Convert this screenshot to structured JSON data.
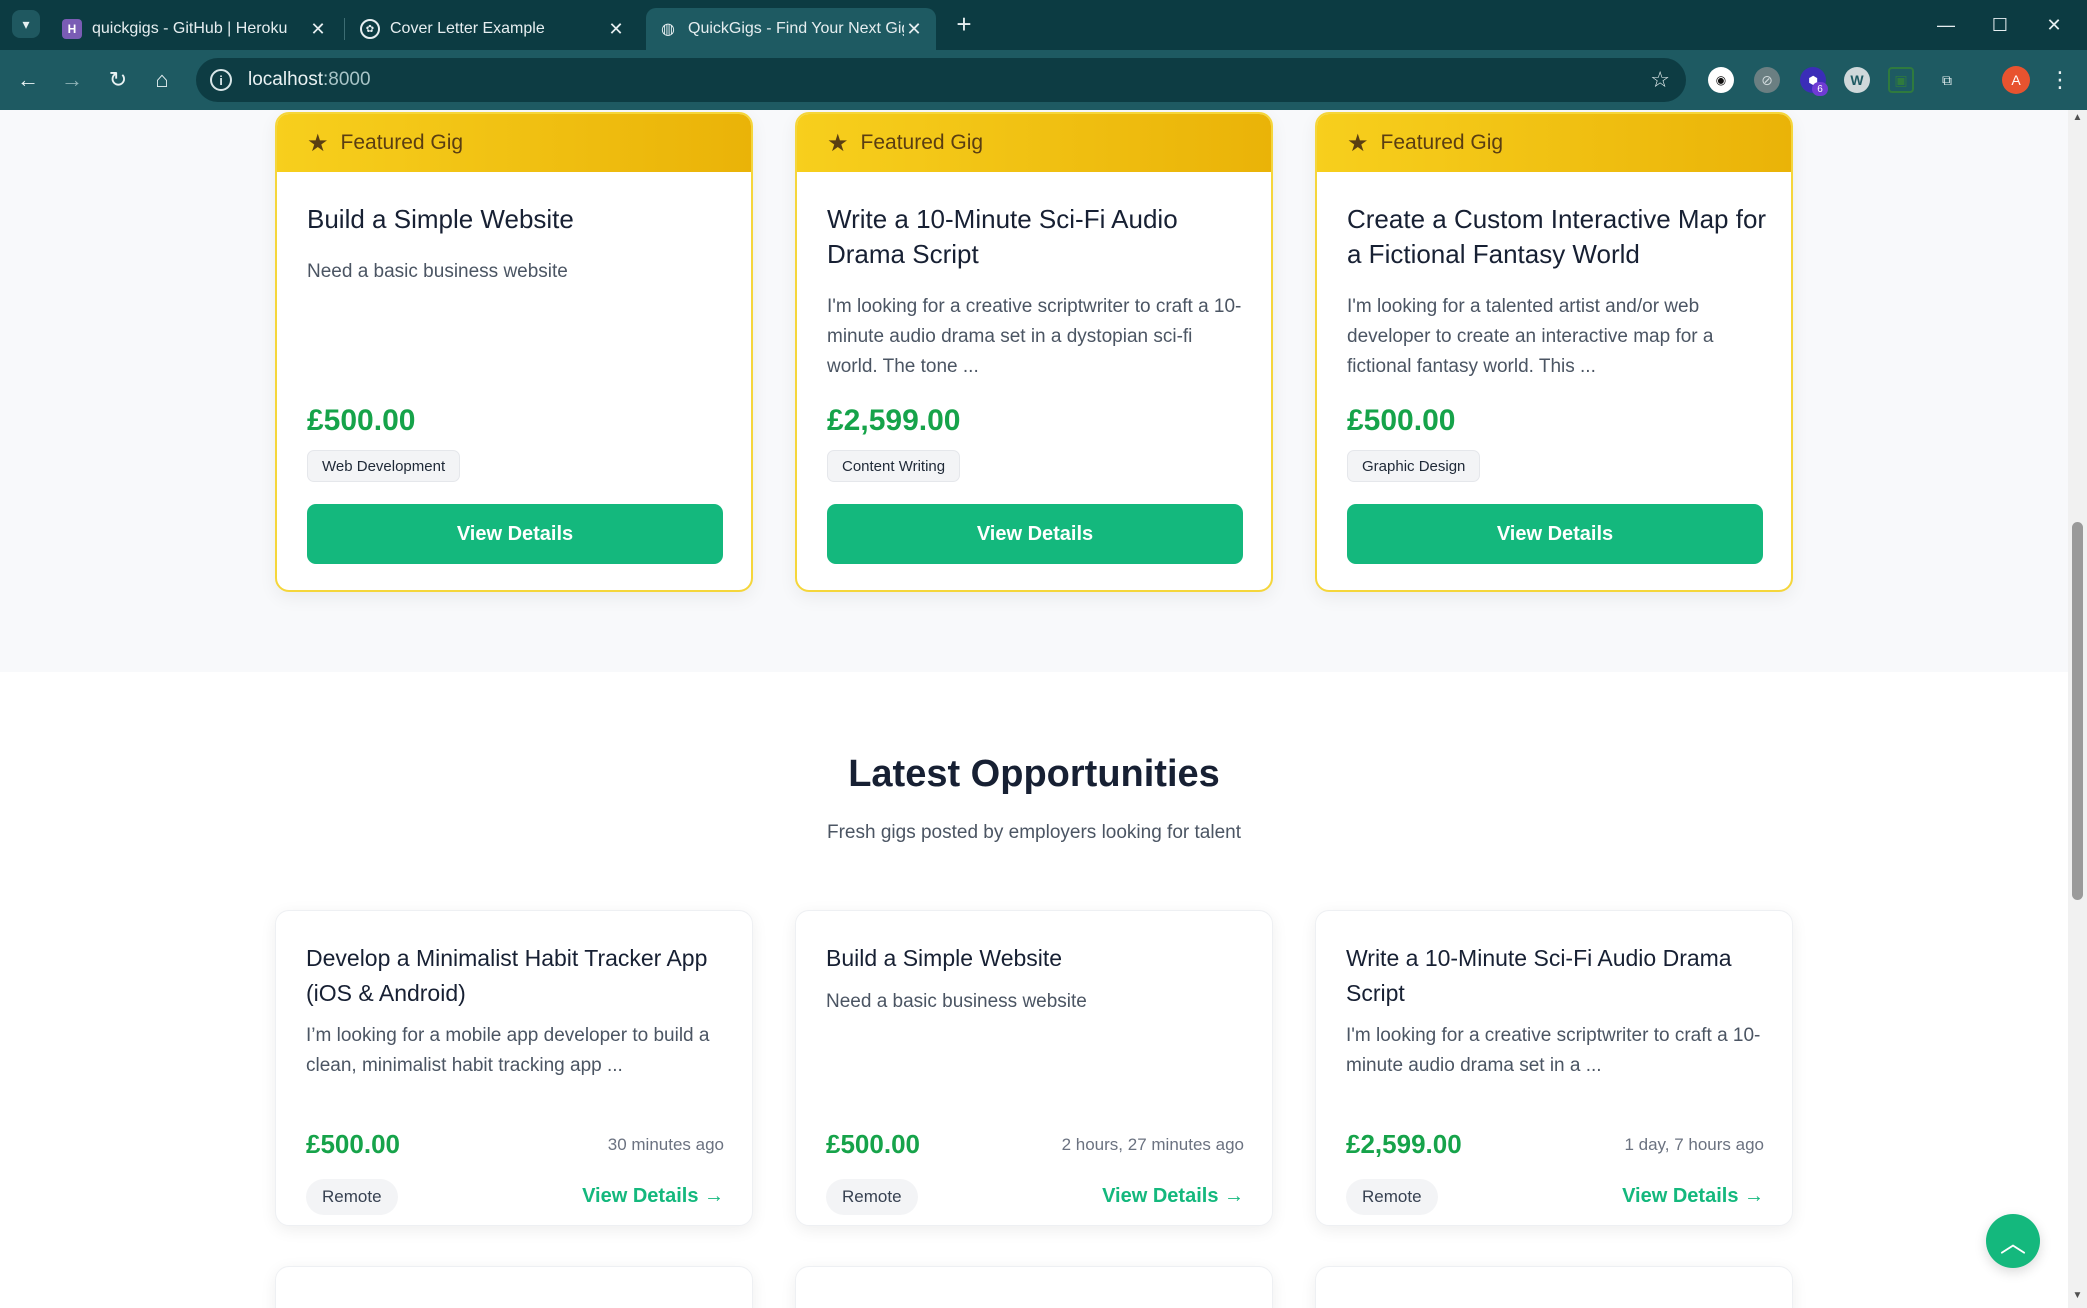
{
  "browser": {
    "tabs": [
      {
        "title": "quickgigs - GitHub | Heroku",
        "favicon": "heroku-icon"
      },
      {
        "title": "Cover Letter Example",
        "favicon": "openai-icon"
      },
      {
        "title": "QuickGigs - Find Your Next Gig",
        "favicon": "globe-icon"
      }
    ],
    "active_tab": 2,
    "url_host": "localhost",
    "url_port": ":8000",
    "profile_initial": "A",
    "extension_badge": "6"
  },
  "featured": {
    "badge_label": "Featured Gig",
    "button_label": "View Details",
    "cards": [
      {
        "title": "Build a Simple Website",
        "description": "Need a basic business website",
        "price": "£500.00",
        "category": "Web Development"
      },
      {
        "title": "Write a 10-Minute Sci-Fi Audio Drama Script",
        "description": "I'm looking for a creative scriptwriter to craft a 10-minute audio drama set in a dystopian sci-fi world. The tone ...",
        "price": "£2,599.00",
        "category": "Content Writing"
      },
      {
        "title": "Create a Custom Interactive Map for a Fictional Fantasy World",
        "description": "I'm looking for a talented artist and/or web developer to create an interactive map for a fictional fantasy world. This ...",
        "price": "£500.00",
        "category": "Graphic Design"
      }
    ]
  },
  "latest": {
    "title": "Latest Opportunities",
    "subtitle": "Fresh gigs posted by employers looking for talent",
    "link_label": "View Details →",
    "cards": [
      {
        "title": "Develop a Minimalist Habit Tracker App (iOS & Android)",
        "description": "I’m looking for a mobile app developer to build a clean, minimalist habit tracking app ...",
        "price": "£500.00",
        "posted": "30 minutes ago",
        "location": "Remote"
      },
      {
        "title": "Build a Simple Website",
        "description": "Need a basic business website",
        "price": "£500.00",
        "posted": "2 hours, 27 minutes ago",
        "location": "Remote"
      },
      {
        "title": "Write a 10-Minute Sci-Fi Audio Drama Script",
        "description": "I'm looking for a creative scriptwriter to craft a 10-minute audio drama set in a ...",
        "price": "£2,599.00",
        "posted": "1 day, 7 hours ago",
        "location": "Remote"
      }
    ]
  },
  "colors": {
    "accent": "#14b87d",
    "price": "#16a34a",
    "featured_header": "#f7cf1d",
    "chrome": "#1e5a62"
  }
}
